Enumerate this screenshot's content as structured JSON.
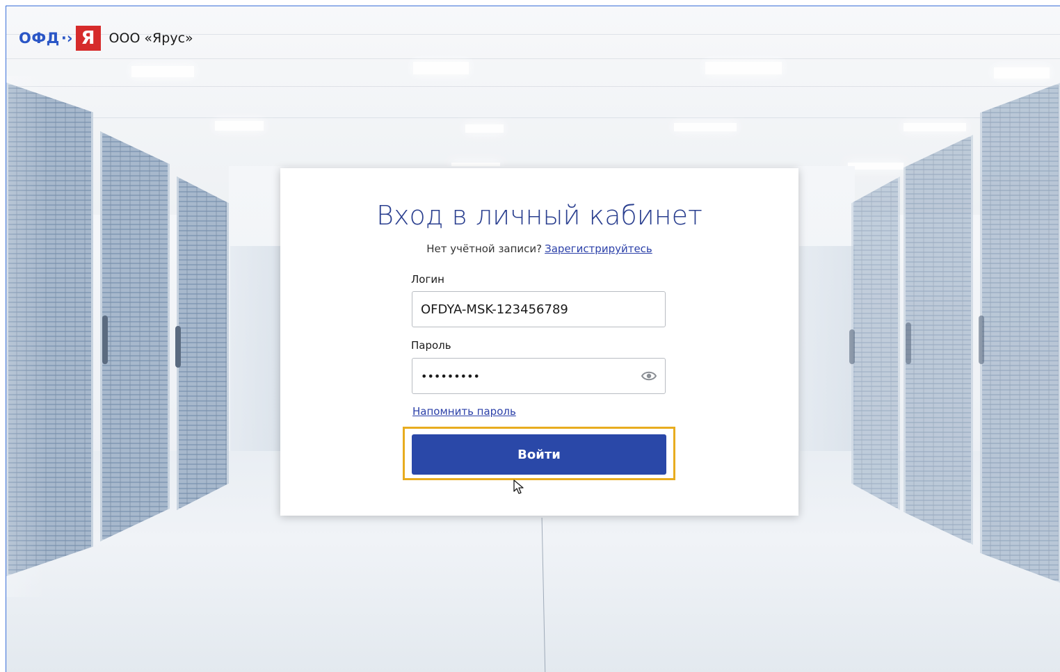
{
  "header": {
    "logo_text": "ОФД",
    "logo_letter": "Я",
    "company": "ООО «Ярус»"
  },
  "login": {
    "title": "Вход в личный кабинет",
    "no_account": "Нет учётной записи?",
    "register_link": "Зарегистрируйтесь",
    "login_label": "Логин",
    "login_value": "OFDYA-MSK-123456789",
    "password_label": "Пароль",
    "password_value": "•••••••••",
    "remind_link": "Напомнить пароль",
    "submit_label": "Войти"
  },
  "colors": {
    "brand_blue": "#2a56c6",
    "brand_red": "#d62b2b",
    "button": "#2a48a8",
    "highlight": "#e8ac1f",
    "title": "#2a3f8f"
  },
  "icons": {
    "password_toggle": "eye-icon",
    "cursor": "mouse-pointer-icon"
  }
}
